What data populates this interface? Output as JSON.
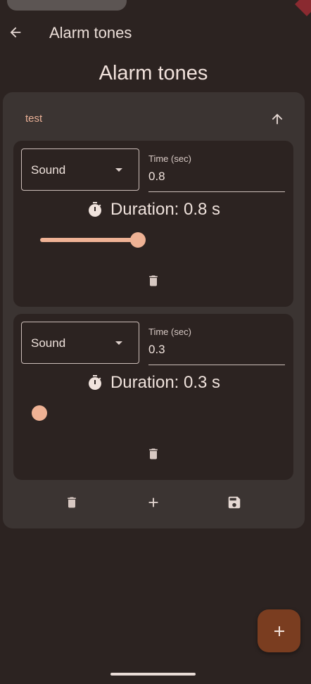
{
  "appbar": {
    "title": "Alarm tones"
  },
  "page": {
    "title": "Alarm tones"
  },
  "group": {
    "name": "test"
  },
  "tones": [
    {
      "sound_label": "Sound",
      "time_label": "Time (sec)",
      "time_value": "0.8",
      "duration_text": "Duration: 0.8 s",
      "slider_level": 1.0
    },
    {
      "sound_label": "Sound",
      "time_label": "Time (sec)",
      "time_value": "0.3",
      "duration_text": "Duration: 0.3 s",
      "slider_level": 0.0
    }
  ],
  "icons": {
    "back": "arrow-left-icon",
    "up": "arrow-up-icon",
    "timer": "timer-icon",
    "delete": "trash-icon",
    "add": "plus-icon",
    "save": "save-icon",
    "fab": "plus-icon"
  },
  "colors": {
    "accent": "#efb295",
    "fab": "#7a3d20",
    "background": "#2c2321",
    "card": "#3b3432"
  }
}
